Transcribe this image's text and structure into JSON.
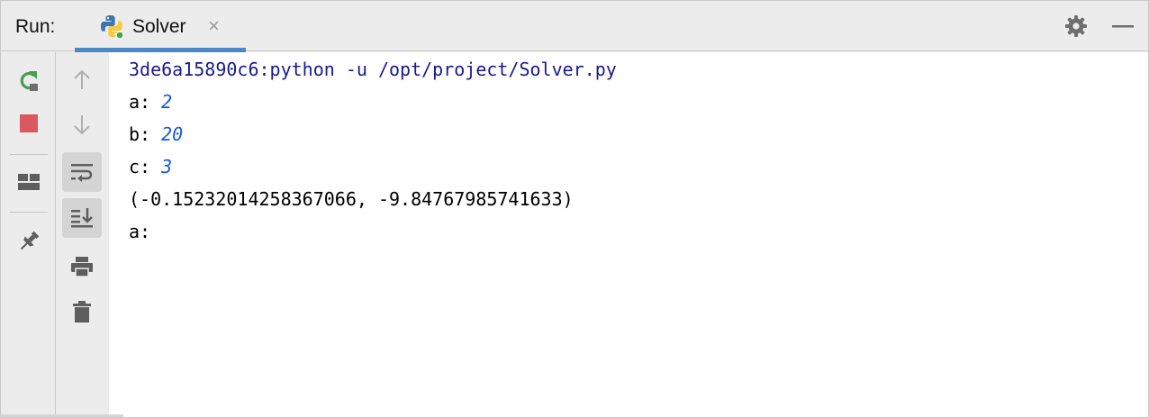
{
  "header": {
    "run_label": "Run:",
    "tab": {
      "label": "Solver",
      "close_glyph": "×",
      "icon": "python-icon"
    },
    "actions": [
      "gear-icon",
      "minimize-icon"
    ]
  },
  "toolbar_left": [
    "rerun-icon",
    "stop-icon",
    "layout-icon",
    "pin-icon"
  ],
  "toolbar_right": [
    "arrow-up-icon",
    "arrow-down-icon",
    "soft-wrap-icon",
    "scroll-to-end-icon",
    "print-icon",
    "trash-icon"
  ],
  "console": {
    "command": "3de6a15890c6:python -u /opt/project/Solver.py",
    "lines": [
      {
        "prompt": "a: ",
        "input": "2"
      },
      {
        "prompt": "b: ",
        "input": "20"
      },
      {
        "prompt": "c: ",
        "input": "3"
      }
    ],
    "result": "(-0.15232014258367066, -9.84767985741633)",
    "last_prompt": "a:"
  },
  "colors": {
    "accent": "#4a88c7",
    "command_text": "#1a1a8c",
    "input_text": "#1b58e0",
    "rerun": "#499c54",
    "stop": "#db5860"
  }
}
